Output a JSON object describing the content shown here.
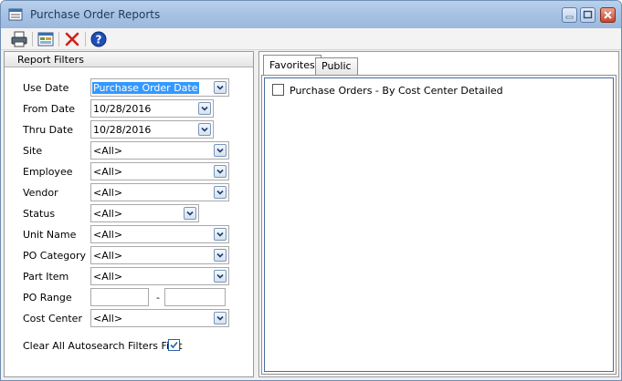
{
  "window": {
    "title": "Purchase Order Reports"
  },
  "toolbar": {
    "icons": [
      "printer-icon",
      "preview-icon",
      "delete-icon",
      "help-icon"
    ]
  },
  "filters": {
    "header": "Report Filters",
    "use_date": {
      "label": "Use Date",
      "value": "Purchase Order Date"
    },
    "from_date": {
      "label": "From Date",
      "value": "10/28/2016"
    },
    "thru_date": {
      "label": "Thru Date",
      "value": "10/28/2016"
    },
    "site": {
      "label": "Site",
      "value": "<All>"
    },
    "employee": {
      "label": "Employee",
      "value": "<All>"
    },
    "vendor": {
      "label": "Vendor",
      "value": "<All>"
    },
    "status": {
      "label": "Status",
      "value": "<All>"
    },
    "unit_name": {
      "label": "Unit Name",
      "value": "<All>"
    },
    "po_category": {
      "label": "PO Category",
      "value": "<All>"
    },
    "part_item": {
      "label": "Part Item",
      "value": "<All>"
    },
    "po_range": {
      "label": "PO  Range",
      "from": "",
      "to": "",
      "separator": "-"
    },
    "cost_center": {
      "label": "Cost Center",
      "value": "<All>"
    },
    "clear_autosearch": {
      "label": "Clear All Autosearch Filters First",
      "checked": true
    }
  },
  "tabs": [
    {
      "label": "Favorites",
      "active": true
    },
    {
      "label": "Public",
      "active": false
    }
  ],
  "reports": [
    {
      "label": "Purchase Orders - By Cost Center Detailed",
      "checked": false
    }
  ],
  "colors": {
    "selection": "#3399ff",
    "titlebar": "#a6c2e3",
    "title_text": "#1e395b",
    "close_button": "#c4462c"
  }
}
